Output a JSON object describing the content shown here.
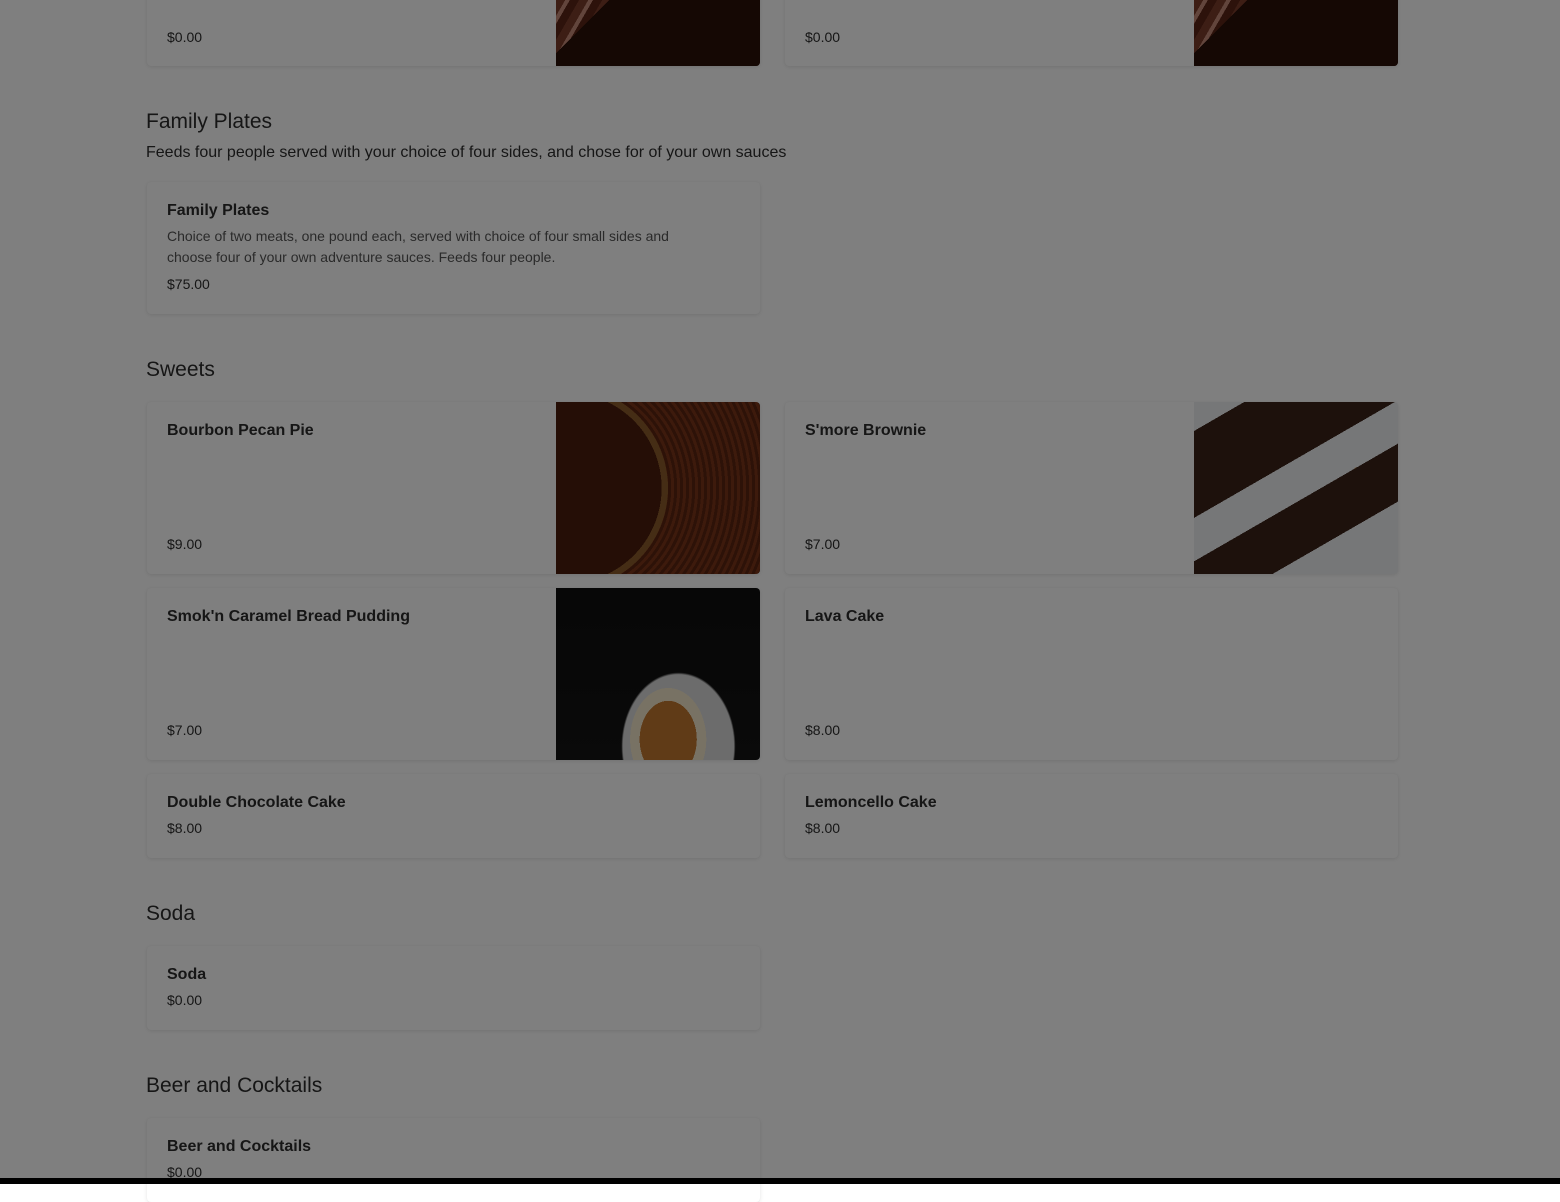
{
  "top_row": [
    {
      "price": "$0.00",
      "image": "cake-image"
    },
    {
      "price": "$0.00",
      "image": "cake-image"
    }
  ],
  "family_plates": {
    "title": "Family Plates",
    "description": "Feeds four people served with your choice of four sides, and chose for of your own sauces",
    "items": [
      {
        "name": "Family Plates",
        "description": "Choice of two meats, one pound each, served with choice of four small sides and choose four of your own adventure sauces. Feeds four people.",
        "price": "$75.00"
      }
    ]
  },
  "sweets": {
    "title": "Sweets",
    "items": [
      {
        "name": "Bourbon Pecan Pie",
        "price": "$9.00",
        "image": "pecan-pie-image"
      },
      {
        "name": "S'more Brownie",
        "price": "$7.00",
        "image": "brownie-image"
      },
      {
        "name": "Smok'n Caramel Bread Pudding",
        "price": "$7.00",
        "image": "bread-pudding-image"
      },
      {
        "name": "Lava Cake",
        "price": "$8.00"
      },
      {
        "name": "Double Chocolate Cake",
        "price": "$8.00"
      },
      {
        "name": "Lemoncello Cake",
        "price": "$8.00"
      }
    ]
  },
  "soda": {
    "title": "Soda",
    "items": [
      {
        "name": "Soda",
        "price": "$0.00"
      }
    ]
  },
  "beer": {
    "title": "Beer and Cocktails",
    "items": [
      {
        "name": "Beer and Cocktails",
        "price": "$0.00"
      }
    ]
  },
  "colors": {
    "overlay": "rgba(0,0,0,0.5)",
    "card_bg": "#ffffff",
    "text": "#2d2d2d"
  }
}
